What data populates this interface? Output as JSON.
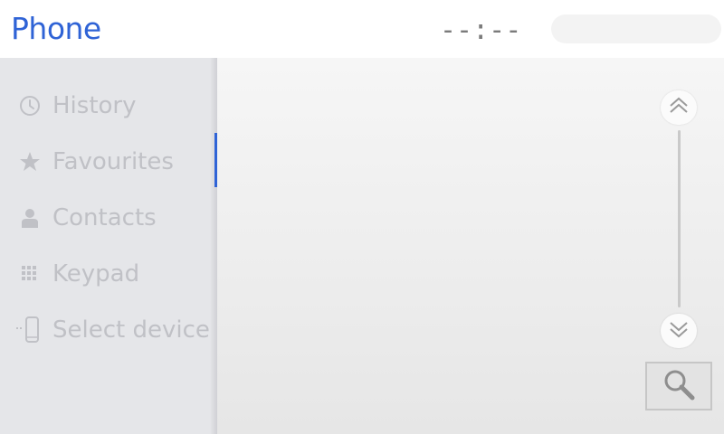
{
  "header": {
    "title": "Phone",
    "clock": "--:--"
  },
  "sidebar": {
    "items": [
      {
        "label": "History",
        "icon": "clock-icon"
      },
      {
        "label": "Favourites",
        "icon": "star-icon"
      },
      {
        "label": "Contacts",
        "icon": "person-icon",
        "selected": true
      },
      {
        "label": "Keypad",
        "icon": "keypad-icon"
      },
      {
        "label": "Select device",
        "icon": "phone-device-icon"
      }
    ]
  },
  "main": {
    "scroll_up_icon": "double-chevron-up-icon",
    "scroll_down_icon": "double-chevron-down-icon",
    "search_icon": "search-icon"
  },
  "colors": {
    "accent": "#2f63d6",
    "sidebar_bg": "#e5e6e9",
    "muted_text": "#c0c1c6"
  }
}
